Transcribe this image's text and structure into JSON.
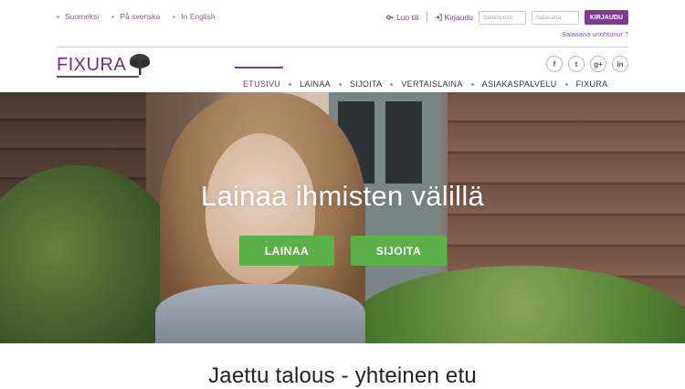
{
  "languages": [
    "Suomeksi",
    "På svenska",
    "In English"
  ],
  "account": {
    "signup_label": "Luo tili",
    "login_link_label": "Kirjaudu",
    "email_placeholder": "Sähköposti",
    "password_placeholder": "Salasana",
    "login_button_label": "KIRJAUDU",
    "forgot_password_label": "Salasana unohtunut ?"
  },
  "brand": {
    "logo_text": "FIXURA"
  },
  "social": [
    {
      "icon": "facebook-icon",
      "glyph": "f"
    },
    {
      "icon": "twitter-icon",
      "glyph": "t"
    },
    {
      "icon": "google-plus-icon",
      "glyph": "g+"
    },
    {
      "icon": "linkedin-icon",
      "glyph": "in"
    }
  ],
  "nav": {
    "items": [
      "ETUSIVU",
      "LAINAA",
      "SIJOITA",
      "VERTAISLAINA",
      "ASIAKASPALVELU",
      "FIXURA"
    ],
    "active_index": 0
  },
  "hero": {
    "title": "Lainaa ihmisten välillä",
    "cta_primary": "LAINAA",
    "cta_secondary": "SIJOITA"
  },
  "tagline": "Jaettu talous - yhteinen etu",
  "colors": {
    "brand_purple": "#7b3a96",
    "cta_green": "#5cb048"
  }
}
